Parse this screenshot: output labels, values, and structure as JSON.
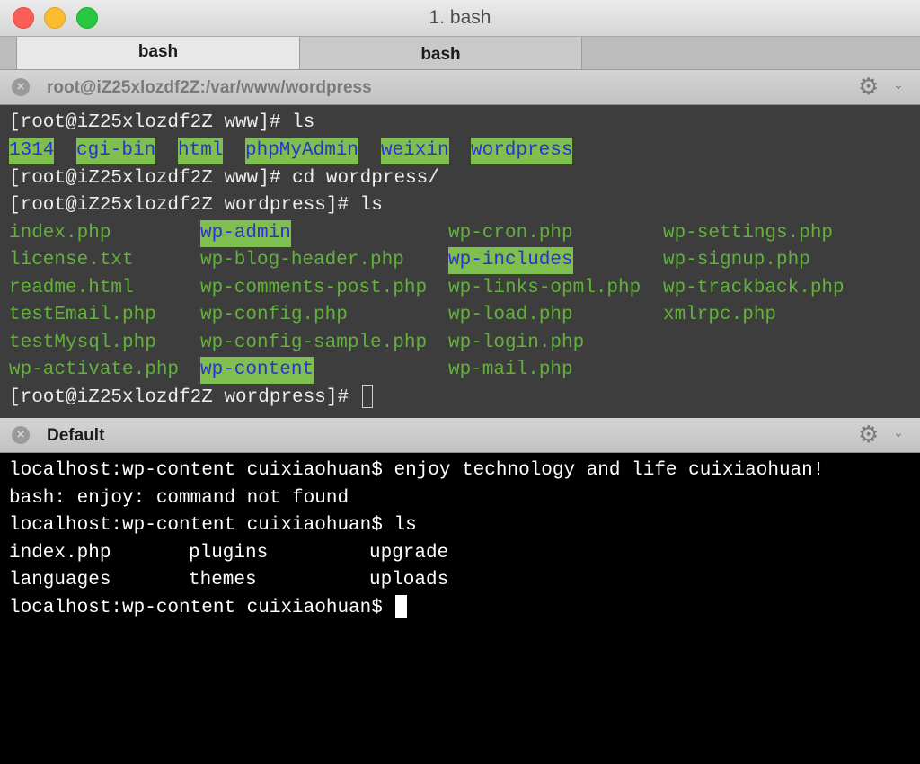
{
  "window": {
    "title": "1. bash"
  },
  "tabs": [
    {
      "label": "bash"
    },
    {
      "label": "bash"
    }
  ],
  "pane1": {
    "title": "root@iZ25xlozdf2Z:/var/www/wordpress",
    "lines": [
      "[root@iZ25xlozdf2Z www]# ls",
      "[root@iZ25xlozdf2Z www]# cd wordpress/",
      "[root@iZ25xlozdf2Z wordpress]# ls",
      "[root@iZ25xlozdf2Z wordpress]# "
    ],
    "ls1": [
      "1314",
      "cgi-bin",
      "html",
      "phpMyAdmin",
      "weixin",
      "wordpress"
    ],
    "ls2": [
      [
        "index.php",
        "wp-admin",
        "wp-cron.php",
        "wp-settings.php"
      ],
      [
        "license.txt",
        "wp-blog-header.php",
        "wp-includes",
        "wp-signup.php"
      ],
      [
        "readme.html",
        "wp-comments-post.php",
        "wp-links-opml.php",
        "wp-trackback.php"
      ],
      [
        "testEmail.php",
        "wp-config.php",
        "wp-load.php",
        "xmlrpc.php"
      ],
      [
        "testMysql.php",
        "wp-config-sample.php",
        "wp-login.php",
        ""
      ],
      [
        "wp-activate.php",
        "wp-content",
        "wp-mail.php",
        ""
      ]
    ]
  },
  "pane2": {
    "title": "Default",
    "lines": [
      "localhost:wp-content cuixiaohuan$ enjoy technology and life cuixiaohuan!",
      "bash: enjoy: command not found",
      "localhost:wp-content cuixiaohuan$ ls",
      "localhost:wp-content cuixiaohuan$ "
    ],
    "ls": [
      [
        "index.php",
        "plugins",
        "upgrade"
      ],
      [
        "languages",
        "themes",
        "uploads"
      ]
    ]
  },
  "icons": {
    "close": "close-icon",
    "gear": "gear-icon",
    "chevron": "chevron-down-icon"
  },
  "colors": {
    "term1_bg": "#3d3d3d",
    "dir_fg": "#2f2fd8",
    "dir_bg": "#7fbf4f",
    "file_fg": "#62b23a"
  }
}
